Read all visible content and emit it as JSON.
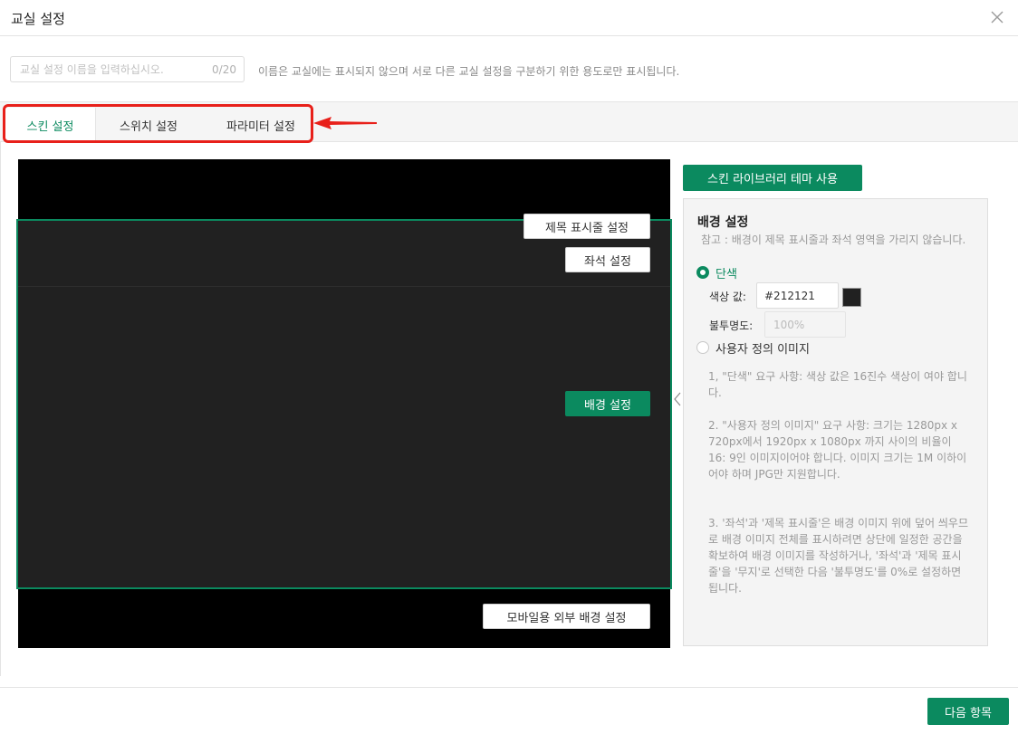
{
  "dialog": {
    "title": "교실 설정"
  },
  "name_field": {
    "placeholder": "교실 설정 이름을 입력하십시오.",
    "value": "",
    "counter": "0/20",
    "hint": "이름은 교실에는 표시되지 않으며 서로 다른 교실 설정을 구분하기 위한 용도로만 표시됩니다."
  },
  "tabs": [
    {
      "label": "스킨 설정",
      "active": true
    },
    {
      "label": "스위치 설정",
      "active": false
    },
    {
      "label": "파라미터 설정",
      "active": false
    }
  ],
  "preview": {
    "title_bar_button": "제목 표시줄 설정",
    "seat_button": "좌석 설정",
    "background_button": "배경 설정",
    "mobile_bg_button": "모바일용 외부 배경 설정"
  },
  "skin_library_button": "스킨 라이브러리 테마 사용",
  "background_settings": {
    "title": "배경 설정",
    "note": "참고 : 배경이 제목 표시줄과 좌석 영역을 가리지 않습니다.",
    "solid_option": "단색",
    "color_label": "색상 값:",
    "color_value": "#212121",
    "swatch_color": "#212121",
    "opacity_label": "불투명도:",
    "opacity_value": "100%",
    "custom_image_option": "사용자 정의 이미지",
    "selected": "solid",
    "notes": [
      "1, \"단색\" 요구 사항: 색상 값은 16진수 색상이 여야 합니다.",
      "2. \"사용자 정의 이미지\" 요구 사항: 크기는 1280px x 720px에서 1920px x 1080px 까지 사이의 비율이 16: 9인 이미지이어야 합니다. 이미지 크기는 1M 이하이어야 하며 JPG만 지원합니다.",
      "3. '좌석'과 '제목 표시줄'은 배경 이미지 위에 덮어 씌우므로 배경 이미지 전체를 표시하려면 상단에 일정한 공간을 확보하여 배경 이미지를 작성하거나, '좌석'과 '제목 표시줄'을 '무지'로 선택한 다음 '불투명도'를 0%로 설정하면 됩니다."
    ]
  },
  "footer": {
    "next_button": "다음 항목"
  },
  "colors": {
    "accent": "#0b8a5f",
    "highlight": "#e8201a",
    "preview_bg": "#000000",
    "preview_area": "#212121"
  }
}
